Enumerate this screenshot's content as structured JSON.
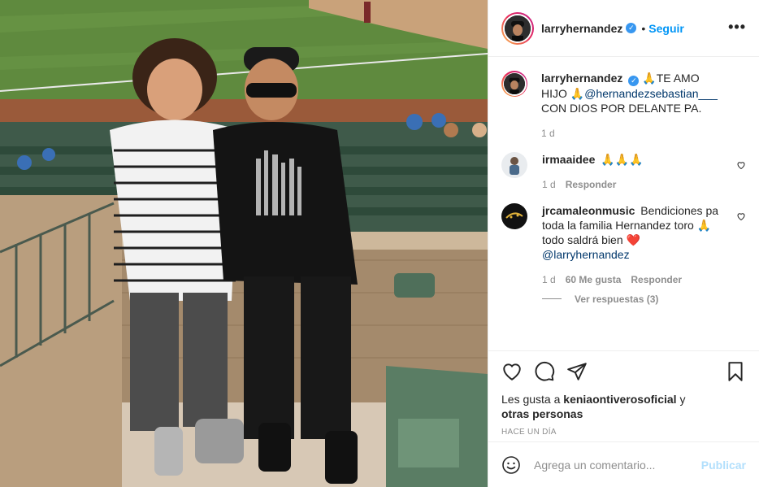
{
  "post": {
    "username": "larryhernandez",
    "separator": "•",
    "follow_label": "Seguir",
    "more_label": "•••"
  },
  "caption": {
    "username": "larryhernandez",
    "emoji_start": "🙏",
    "text_start": "TE AMO HIJO",
    "emoji_mid": "🙏",
    "mention": "@hernandezsebastian___",
    "text_end": " CON DIOS POR DELANTE PA.",
    "time": "1 d"
  },
  "comments": [
    {
      "username": "irmaaidee",
      "text": "🙏🙏🙏",
      "time": "1 d",
      "reply_label": "Responder"
    },
    {
      "username": "jrcamaleonmusic",
      "text": "Bendiciones pa toda la familia Hernandez toro 🙏 todo saldrá bien ❤️",
      "mention": "@larryhernandez",
      "time": "1 d",
      "likes": "60 Me gusta",
      "reply_label": "Responder",
      "view_replies": "Ver respuestas (3)"
    }
  ],
  "likes": {
    "prefix": "Les gusta a ",
    "user": "keniaontiverosoficial",
    "middle": " y",
    "others": "otras personas"
  },
  "timestamp": "HACE UN DÍA",
  "add_comment": {
    "placeholder": "Agrega un comentario...",
    "publish_label": "Publicar"
  },
  "colors": {
    "link": "#0095f6",
    "verified": "#3897f0",
    "publish_disabled": "#b2dffc",
    "muted": "#8e8e8e"
  }
}
